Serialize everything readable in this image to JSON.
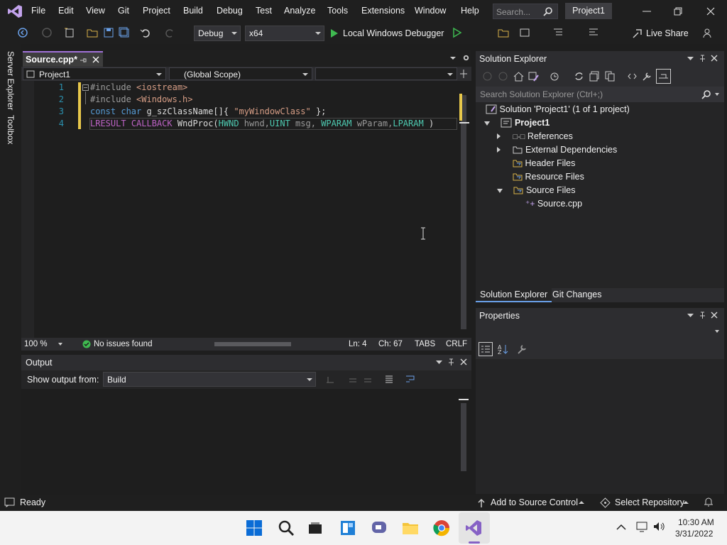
{
  "menu": [
    "File",
    "Edit",
    "View",
    "Git",
    "Project",
    "Build",
    "Debug",
    "Test",
    "Analyze",
    "Tools",
    "Extensions",
    "Window",
    "Help"
  ],
  "search_placeholder": "Search...",
  "solution_name": "Project1",
  "toolbar": {
    "config": "Debug",
    "platform": "x64",
    "run_label": "Local Windows Debugger",
    "live_share": "Live Share"
  },
  "left_rail": {
    "server_explorer": "Server Explorer",
    "toolbox": "Toolbox"
  },
  "editor": {
    "tab": "Source.cpp*",
    "nav_project": "Project1",
    "nav_scope": "(Global Scope)",
    "line_numbers": [
      "1",
      "2",
      "3",
      "4"
    ],
    "status": {
      "zoom": "100 %",
      "issues": "No issues found",
      "ln": "Ln: 4",
      "ch": "Ch: 67",
      "tabs": "TABS",
      "eol": "CRLF"
    }
  },
  "code": {
    "l1_kw": "#include",
    "l1_arg": "<iostream>",
    "l2_kw": "#include",
    "l2_arg": "<Windows.h>",
    "l3_a": "const",
    "l3_b": "char",
    "l3_c": "g_szClassName[]{",
    "l3_d": "\"myWindowClass\"",
    "l3_e": "};",
    "l4_a": "LRESULT",
    "l4_b": "CALLBACK",
    "l4_c": "WndProc(",
    "l4_d": "HWND",
    "l4_e": "hwnd,",
    "l4_f": "UINT",
    "l4_g": "msg,",
    "l4_h": "WPARAM",
    "l4_i": "wParam,",
    "l4_j": "LPARAM",
    "l4_k": ")"
  },
  "output": {
    "title": "Output",
    "show_from_label": "Show output from:",
    "source": "Build"
  },
  "solution_explorer": {
    "title": "Solution Explorer",
    "search_placeholder": "Search Solution Explorer (Ctrl+;)",
    "solution": "Solution 'Project1' (1 of 1 project)",
    "project": "Project1",
    "items": [
      "References",
      "External Dependencies",
      "Header Files",
      "Resource Files",
      "Source Files"
    ],
    "source_file": "Source.cpp",
    "tabs": [
      "Solution Explorer",
      "Git Changes"
    ]
  },
  "properties": {
    "title": "Properties"
  },
  "statusbar": {
    "ready": "Ready",
    "add_source": "Add to Source Control",
    "select_repo": "Select Repository"
  },
  "clock": {
    "time": "10:30 AM",
    "date": "3/31/2022"
  },
  "colors": {
    "accent": "#a071d8",
    "change_bar": "#e8c84b"
  }
}
